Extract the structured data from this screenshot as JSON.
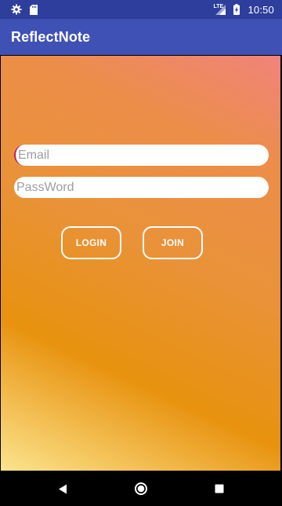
{
  "status_bar": {
    "time": "10:50",
    "network_label": "LTE",
    "icons": [
      "gear-icon",
      "sd-card-icon",
      "signal-icon",
      "battery-icon"
    ]
  },
  "app_bar": {
    "title": "ReflectNote"
  },
  "form": {
    "email_placeholder": "Email",
    "email_value": "",
    "password_placeholder": "PassWord",
    "password_value": "",
    "login_label": "LOGIN",
    "join_label": "JOIN"
  },
  "nav_bar": {
    "icons": [
      "back-icon",
      "home-icon",
      "recents-icon"
    ]
  },
  "colors": {
    "status_bar": "#2e3e9c",
    "app_bar": "#3f51b5",
    "gradient_top": "#f0837a",
    "gradient_mid": "#e8920f",
    "gradient_bottom": "#fbe48e",
    "cursor": "#c2185b"
  }
}
